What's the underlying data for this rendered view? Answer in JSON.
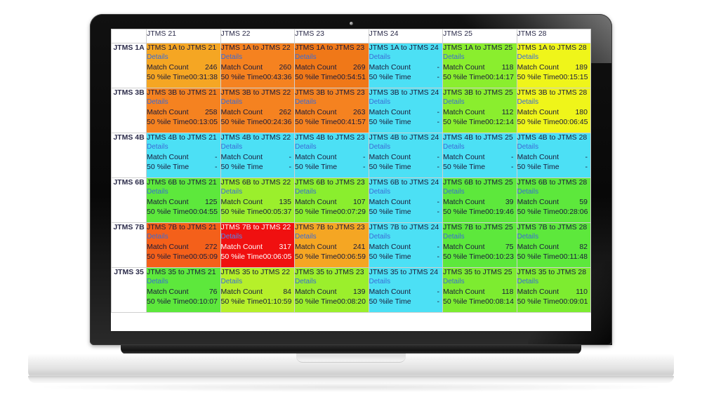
{
  "device": {
    "type": "laptop-mockup",
    "camera": "camera-dot"
  },
  "table": {
    "corner_label": "",
    "columns": [
      "JTMS 21",
      "JTMS 22",
      "JTMS 23",
      "JTMS 24",
      "JTMS 25",
      "JTMS 28"
    ],
    "rows": [
      "JTMS 1A",
      "JTMS 3B",
      "JTMS 4B",
      "JTMS 6B",
      "JTMS 7B",
      "JTMS 35"
    ],
    "labels": {
      "details": "Details",
      "match_count": "Match Count",
      "pctile_time": "50 %ile Time"
    },
    "colors": {
      "orange_light": "#F5A623",
      "orange": "#F58220",
      "orange_deep": "#F07818",
      "cyan": "#4CE0F5",
      "green": "#5DE83C",
      "green_bright": "#6EEB3C",
      "yellow_green": "#B6F02A",
      "yellow": "#EFF51A",
      "red": "#F01010",
      "link": "#3B6BD6",
      "text": "#1A1A3A",
      "grid": "#CFCFCF"
    },
    "cells": [
      [
        {
          "title": "JTMS 1A to JTMS 21",
          "count": "246",
          "time": "00:31:38",
          "bg": "#F5A623",
          "invert": false
        },
        {
          "title": "JTMS 1A to JTMS 22",
          "count": "260",
          "time": "00:43:36",
          "bg": "#F58220",
          "invert": false
        },
        {
          "title": "JTMS 1A to JTMS 23",
          "count": "269",
          "time": "00:54:51",
          "bg": "#F07818",
          "invert": false
        },
        {
          "title": "JTMS 1A to JTMS 24",
          "count": "-",
          "time": "-",
          "bg": "#4CE0F5",
          "invert": false
        },
        {
          "title": "JTMS 1A to JTMS 25",
          "count": "118",
          "time": "00:14:17",
          "bg": "#8AEE2E",
          "invert": false
        },
        {
          "title": "JTMS 1A to JTMS 28",
          "count": "189",
          "time": "00:15:15",
          "bg": "#EFF51A",
          "invert": false
        }
      ],
      [
        {
          "title": "JTMS 3B to JTMS 21",
          "count": "258",
          "time": "00:13:05",
          "bg": "#F58220",
          "invert": false
        },
        {
          "title": "JTMS 3B to JTMS 22",
          "count": "262",
          "time": "00:24:36",
          "bg": "#F58220",
          "invert": false
        },
        {
          "title": "JTMS 3B to JTMS 23",
          "count": "263",
          "time": "00:41:57",
          "bg": "#F58220",
          "invert": false
        },
        {
          "title": "JTMS 3B to JTMS 24",
          "count": "-",
          "time": "-",
          "bg": "#4CE0F5",
          "invert": false
        },
        {
          "title": "JTMS 3B to JTMS 25",
          "count": "112",
          "time": "00:12:14",
          "bg": "#8AEE2E",
          "invert": false
        },
        {
          "title": "JTMS 3B to JTMS 28",
          "count": "180",
          "time": "00:06:45",
          "bg": "#EFF51A",
          "invert": false
        }
      ],
      [
        {
          "title": "JTMS 4B to JTMS 21",
          "count": "-",
          "time": "-",
          "bg": "#4CE0F5",
          "invert": false
        },
        {
          "title": "JTMS 4B to JTMS 22",
          "count": "-",
          "time": "-",
          "bg": "#4CE0F5",
          "invert": false
        },
        {
          "title": "JTMS 4B to JTMS 23",
          "count": "-",
          "time": "-",
          "bg": "#4CE0F5",
          "invert": false
        },
        {
          "title": "JTMS 4B to JTMS 24",
          "count": "-",
          "time": "-",
          "bg": "#4CE0F5",
          "invert": false
        },
        {
          "title": "JTMS 4B to JTMS 25",
          "count": "-",
          "time": "-",
          "bg": "#4CE0F5",
          "invert": false
        },
        {
          "title": "JTMS 4B to JTMS 28",
          "count": "-",
          "time": "-",
          "bg": "#4CE0F5",
          "invert": false
        }
      ],
      [
        {
          "title": "JTMS 6B to JTMS 21",
          "count": "125",
          "time": "00:04:55",
          "bg": "#5DE83C",
          "invert": false
        },
        {
          "title": "JTMS 6B to JTMS 22",
          "count": "135",
          "time": "00:05:37",
          "bg": "#9BEF2C",
          "invert": false
        },
        {
          "title": "JTMS 6B to JTMS 23",
          "count": "107",
          "time": "00:07:29",
          "bg": "#8AEE2E",
          "invert": false
        },
        {
          "title": "JTMS 6B to JTMS 24",
          "count": "-",
          "time": "-",
          "bg": "#4CE0F5",
          "invert": false
        },
        {
          "title": "JTMS 6B to JTMS 25",
          "count": "39",
          "time": "00:19:46",
          "bg": "#5DE83C",
          "invert": false
        },
        {
          "title": "JTMS 6B to JTMS 28",
          "count": "59",
          "time": "00:28:06",
          "bg": "#5DE83C",
          "invert": false
        }
      ],
      [
        {
          "title": "JTMS 7B to JTMS 21",
          "count": "272",
          "time": "00:05:09",
          "bg": "#F4601A",
          "invert": false
        },
        {
          "title": "JTMS 7B to JTMS 22",
          "count": "317",
          "time": "00:06:05",
          "bg": "#F01010",
          "invert": true
        },
        {
          "title": "JTMS 7B to JTMS 23",
          "count": "241",
          "time": "00:06:59",
          "bg": "#F5A623",
          "invert": false
        },
        {
          "title": "JTMS 7B to JTMS 24",
          "count": "-",
          "time": "-",
          "bg": "#4CE0F5",
          "invert": false
        },
        {
          "title": "JTMS 7B to JTMS 25",
          "count": "75",
          "time": "00:10:23",
          "bg": "#5DE83C",
          "invert": false
        },
        {
          "title": "JTMS 7B to JTMS 28",
          "count": "82",
          "time": "00:11:48",
          "bg": "#5DE83C",
          "invert": false
        }
      ],
      [
        {
          "title": "JTMS 35 to JTMS 21",
          "count": "76",
          "time": "00:10:07",
          "bg": "#5DE83C",
          "invert": false
        },
        {
          "title": "JTMS 35 to JTMS 22",
          "count": "84",
          "time": "01:10:59",
          "bg": "#B6F02A",
          "invert": false
        },
        {
          "title": "JTMS 35 to JTMS 23",
          "count": "139",
          "time": "00:08:20",
          "bg": "#9BEF2C",
          "invert": false
        },
        {
          "title": "JTMS 35 to JTMS 24",
          "count": "-",
          "time": "-",
          "bg": "#4CE0F5",
          "invert": false
        },
        {
          "title": "JTMS 35 to JTMS 25",
          "count": "118",
          "time": "00:08:14",
          "bg": "#7DEC30",
          "invert": false
        },
        {
          "title": "JTMS 35 to JTMS 28",
          "count": "110",
          "time": "00:09:01",
          "bg": "#7DEC30",
          "invert": false
        }
      ]
    ]
  }
}
